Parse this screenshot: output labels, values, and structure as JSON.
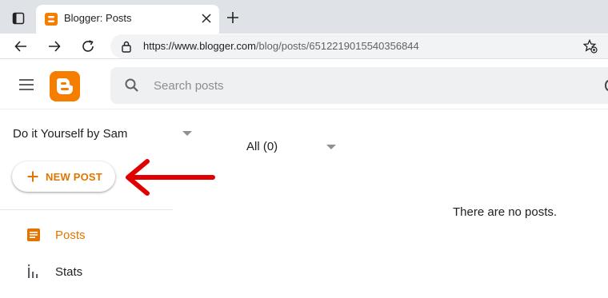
{
  "browser": {
    "tab": {
      "title": "Blogger: Posts"
    },
    "url": {
      "host": "https://www.blogger.com",
      "path": "/blog/posts/6512219015540356844"
    }
  },
  "colors": {
    "accent": "#f57d00",
    "accent_text": "#e37400",
    "annotation_arrow": "#e00000"
  },
  "header": {
    "search_placeholder": "Search posts"
  },
  "sidebar": {
    "blog_name": "Do it Yourself by Sam",
    "new_post_label": "NEW POST",
    "items": [
      {
        "label": "Posts",
        "icon": "posts-icon",
        "active": true
      },
      {
        "label": "Stats",
        "icon": "stats-icon",
        "active": false
      }
    ]
  },
  "main": {
    "filter_label": "All (0)",
    "empty_message": "There are no posts."
  }
}
